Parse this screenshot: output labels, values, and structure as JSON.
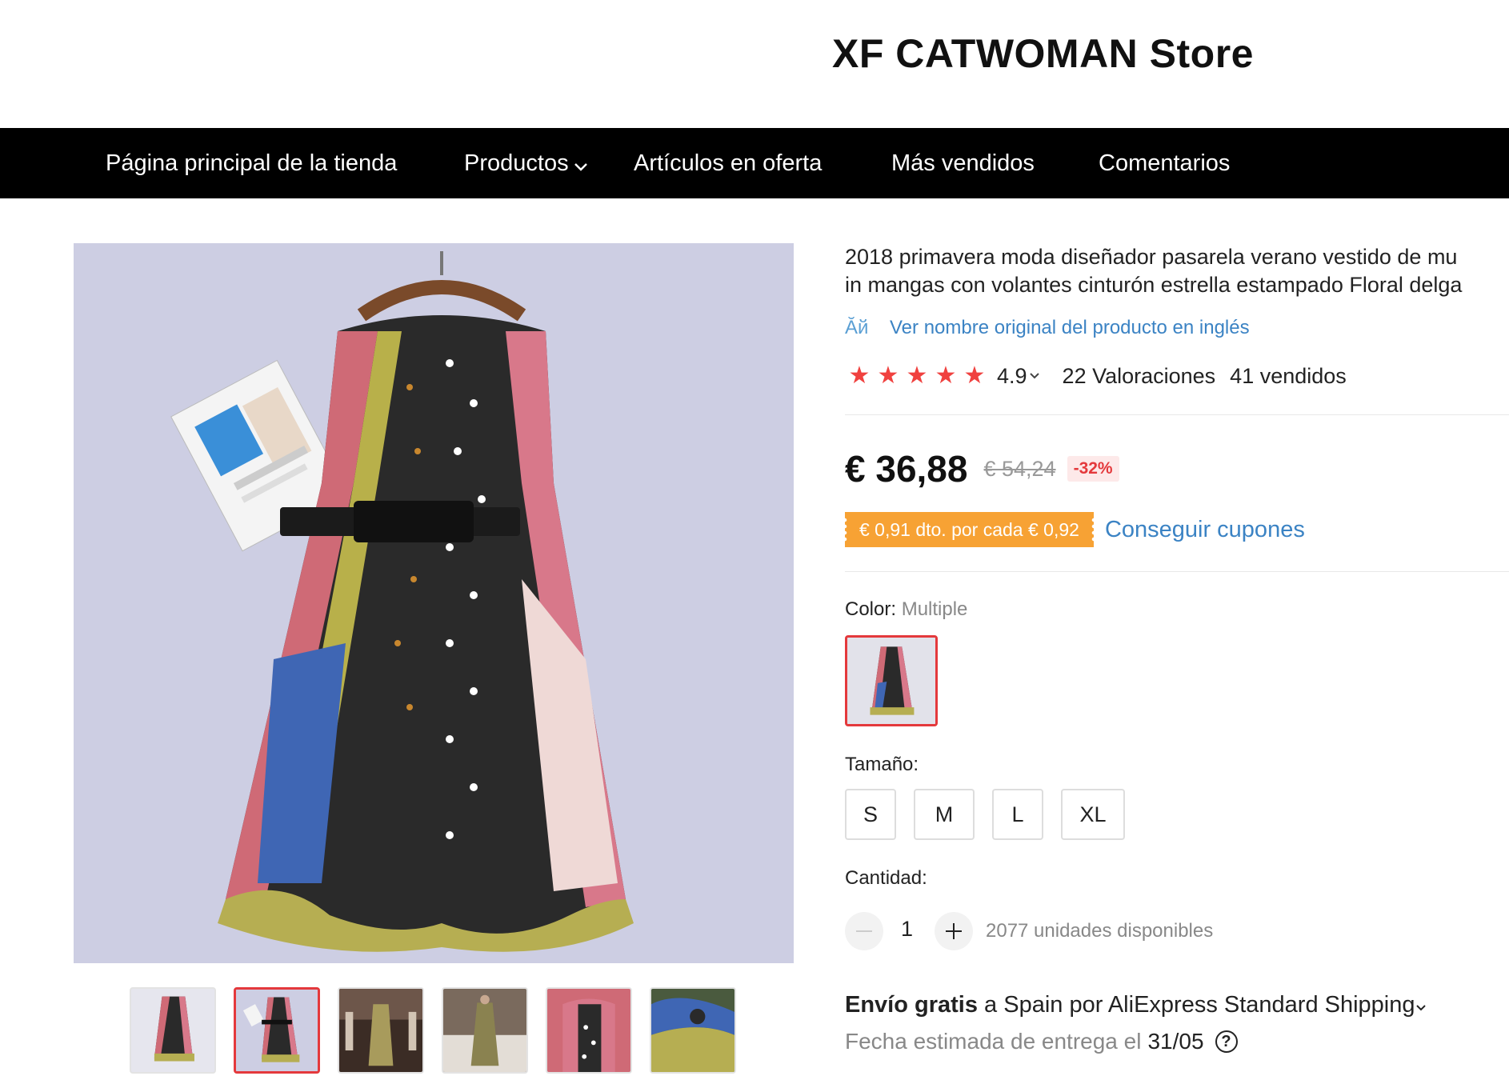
{
  "header": {
    "store_name": "XF CATWOMAN Store"
  },
  "nav": {
    "items": [
      {
        "label": "Página principal de la tienda"
      },
      {
        "label": "Productos",
        "has_dropdown": true
      },
      {
        "label": "Artículos en oferta"
      },
      {
        "label": "Más vendidos"
      },
      {
        "label": "Comentarios"
      }
    ]
  },
  "gallery": {
    "thumbnails_count": 6,
    "active_thumbnail": 2
  },
  "product": {
    "title_line1": "2018 primavera moda diseñador pasarela verano vestido de mu",
    "title_line2": "in mangas con volantes cinturón estrella estampado Floral delga",
    "translate_icon_text": "Ăй",
    "translate_link": "Ver nombre original del producto en inglés",
    "rating": "4.9",
    "rating_chevron": "⌄",
    "stars_filled": 5,
    "reviews": "22 Valoraciones",
    "sold": "41 vendidos",
    "price": "€ 36,88",
    "old_price": "€ 54,24",
    "discount": "-32%",
    "coupon": "€ 0,91 dto. por cada € 0,92",
    "coupon_link": "Conseguir cupones",
    "color_label": "Color:",
    "color_value": "Multiple",
    "size_label": "Tamaño:",
    "sizes": [
      "S",
      "M",
      "L",
      "XL"
    ],
    "quantity_label": "Cantidad:",
    "quantity_value": "1",
    "stock": "2077 unidades disponibles",
    "shipping_free": "Envío gratis",
    "shipping_rest": " a Spain por AliExpress Standard Shipping",
    "eta_label": "Fecha estimada de entrega el",
    "eta_date": "31/05"
  },
  "colors": {
    "accent_red": "#e4393c",
    "coupon_orange": "#f7a234",
    "link_blue": "#3b83c4",
    "star_red": "#f0413f"
  }
}
